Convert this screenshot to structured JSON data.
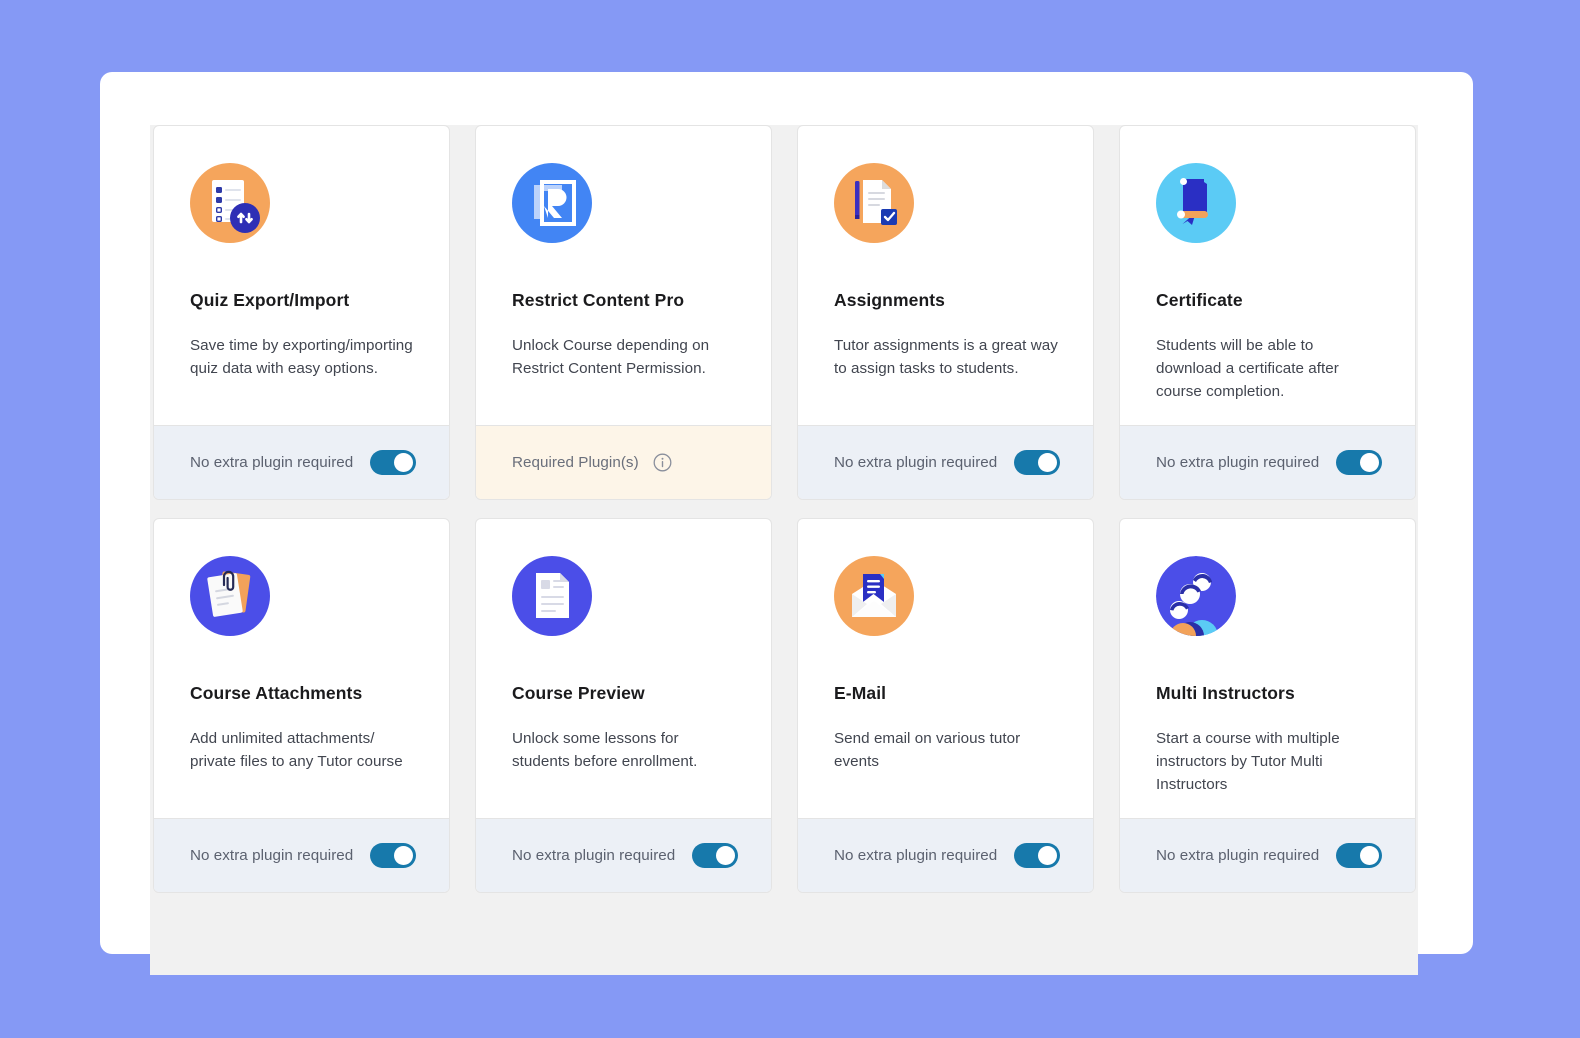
{
  "theme": {
    "page_background": "#8599F5",
    "panel_background": "#FFFFFF",
    "grid_background": "#F1F1F1",
    "card_background": "#FFFFFF",
    "footer_background": "#ECF0F6",
    "footer_required_background": "#FDF5E8",
    "toggle_on_color": "#1779AB",
    "selection_outline_color": "#E8392B"
  },
  "labels": {
    "no_extra_plugin": "No extra plugin required",
    "required_plugins": "Required Plugin(s)"
  },
  "addons": [
    {
      "id": "quiz-export-import",
      "title": "Quiz Export/Import",
      "description": "Save time by exporting/importing quiz data with easy options.",
      "icon_name": "quiz-export-import-icon",
      "icon_bg": "#F5A55C",
      "footer_label": "No extra plugin required",
      "footer_type": "toggle",
      "toggle_on": true,
      "selected": true
    },
    {
      "id": "restrict-content-pro",
      "title": "Restrict Content Pro",
      "description": "Unlock Course depending on Restrict Content Permission.",
      "icon_name": "restrict-content-pro-icon",
      "icon_bg": "#4285F4",
      "footer_label": "Required Plugin(s)",
      "footer_type": "required",
      "toggle_on": false,
      "selected": false
    },
    {
      "id": "assignments",
      "title": "Assignments",
      "description": "Tutor assignments is a great way to assign tasks to students.",
      "icon_name": "assignments-icon",
      "icon_bg": "#F5A55C",
      "footer_label": "No extra plugin required",
      "footer_type": "toggle",
      "toggle_on": true,
      "selected": false
    },
    {
      "id": "certificate",
      "title": "Certificate",
      "description": "Students will be able to download a certificate after course completion.",
      "icon_name": "certificate-icon",
      "icon_bg": "#5BCBF5",
      "footer_label": "No extra plugin required",
      "footer_type": "toggle",
      "toggle_on": true,
      "selected": false
    },
    {
      "id": "course-attachments",
      "title": "Course Attachments",
      "description": "Add unlimited attachments/ private files to any Tutor course",
      "icon_name": "course-attachments-icon",
      "icon_bg": "#4B4EE8",
      "footer_label": "No extra plugin required",
      "footer_type": "toggle",
      "toggle_on": true,
      "selected": false
    },
    {
      "id": "course-preview",
      "title": "Course Preview",
      "description": "Unlock some lessons for students before enrollment.",
      "icon_name": "course-preview-icon",
      "icon_bg": "#4B4EE8",
      "footer_label": "No extra plugin required",
      "footer_type": "toggle",
      "toggle_on": true,
      "selected": false
    },
    {
      "id": "e-mail",
      "title": "E-Mail",
      "description": "Send email on various tutor events",
      "icon_name": "email-icon",
      "icon_bg": "#F5A55C",
      "footer_label": "No extra plugin required",
      "footer_type": "toggle",
      "toggle_on": true,
      "selected": false
    },
    {
      "id": "multi-instructors",
      "title": "Multi Instructors",
      "description": "Start a course with multiple instructors by Tutor Multi Instructors",
      "icon_name": "multi-instructors-icon",
      "icon_bg": "#4B4EE8",
      "footer_label": "No extra plugin required",
      "footer_type": "toggle",
      "toggle_on": true,
      "selected": false
    }
  ]
}
